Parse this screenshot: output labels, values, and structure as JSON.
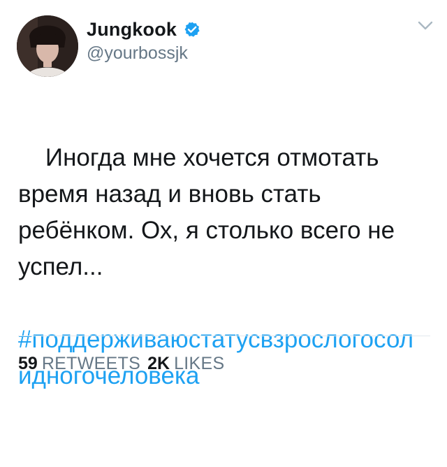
{
  "user": {
    "display_name": "Jungkook",
    "handle": "@yourbossjk",
    "verified": true
  },
  "tweet": {
    "text": "Иногда мне хочется отмотать время назад и вновь стать ребёнком. Ох, я столько всего не успел...",
    "hashtag": "#поддерживаюстатусвзрослогосолидногочеловека"
  },
  "stats": {
    "retweets_count": "59",
    "retweets_label": "RETWEETS",
    "likes_count": "2K",
    "likes_label": "LIKES"
  },
  "colors": {
    "link": "#1da1f2",
    "text": "#14171a",
    "muted": "#657786",
    "divider": "#e1e8ed"
  },
  "icons": {
    "verified": "verified-badge-icon",
    "menu": "chevron-down-icon"
  }
}
